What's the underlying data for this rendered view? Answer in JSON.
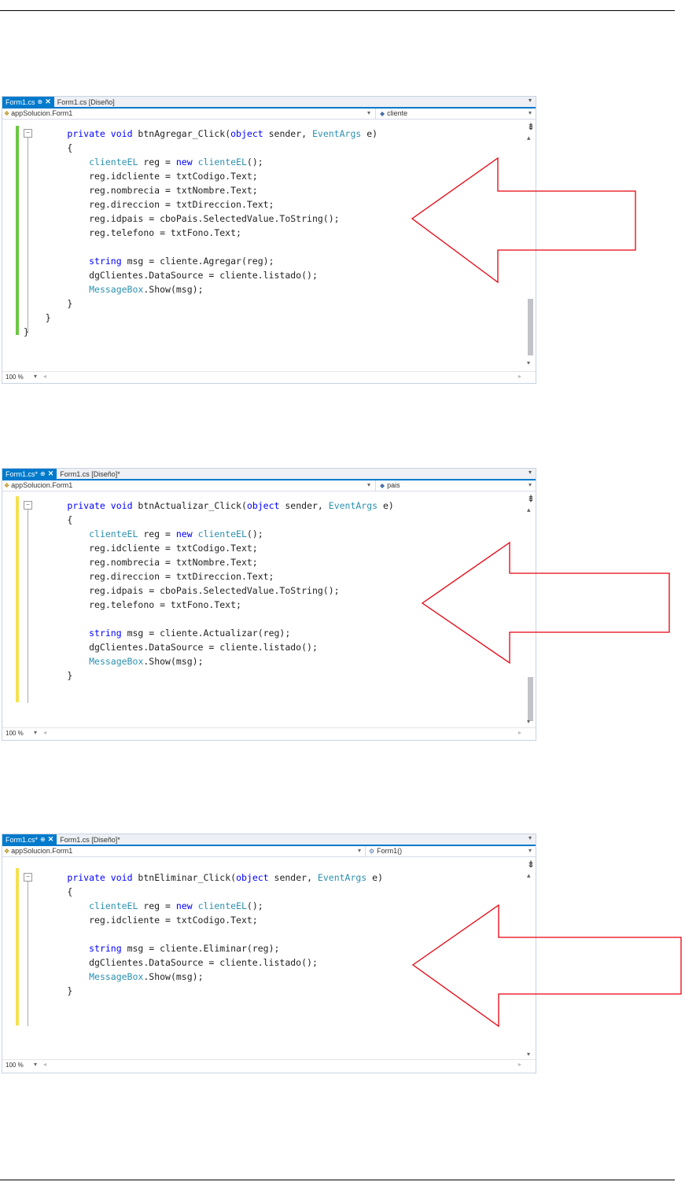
{
  "screenshots": [
    {
      "tab_active": "Form1.cs",
      "tab_inactive": "Form1.cs [Diseño]",
      "nav_class": "appSolucion.Form1",
      "nav_member": "cliente",
      "zoom": "100 %",
      "lines": [
        "        private void btnAgregar_Click(object sender, EventArgs e)",
        "        {",
        "            clienteEL reg = new clienteEL();",
        "            reg.idcliente = txtCodigo.Text;",
        "            reg.nombrecia = txtNombre.Text;",
        "            reg.direccion = txtDireccion.Text;",
        "            reg.idpais = cboPais.SelectedValue.ToString();",
        "            reg.telefono = txtFono.Text;",
        "",
        "            string msg = cliente.Agregar(reg);",
        "            dgClientes.DataSource = cliente.listado();",
        "            MessageBox.Show(msg);",
        "        }",
        "    }",
        "}"
      ]
    },
    {
      "tab_active": "Form1.cs*",
      "tab_inactive": "Form1.cs [Diseño]*",
      "nav_class": "appSolucion.Form1",
      "nav_member": "pais",
      "zoom": "100 %",
      "lines": [
        "        private void btnActualizar_Click(object sender, EventArgs e)",
        "        {",
        "            clienteEL reg = new clienteEL();",
        "            reg.idcliente = txtCodigo.Text;",
        "            reg.nombrecia = txtNombre.Text;",
        "            reg.direccion = txtDireccion.Text;",
        "            reg.idpais = cboPais.SelectedValue.ToString();",
        "            reg.telefono = txtFono.Text;",
        "",
        "            string msg = cliente.Actualizar(reg);",
        "            dgClientes.DataSource = cliente.listado();",
        "            MessageBox.Show(msg);",
        "        }"
      ]
    },
    {
      "tab_active": "Form1.cs*",
      "tab_inactive": "Form1.cs [Diseño]*",
      "nav_class": "appSolucion.Form1",
      "nav_member": "Form1()",
      "zoom": "100 %",
      "lines": [
        "        private void btnEliminar_Click(object sender, EventArgs e)",
        "        {",
        "            clienteEL reg = new clienteEL();",
        "            reg.idcliente = txtCodigo.Text;",
        "",
        "            string msg = cliente.Eliminar(reg);",
        "            dgClientes.DataSource = cliente.listado();",
        "            MessageBox.Show(msg);",
        "        }"
      ]
    }
  ],
  "colors": {
    "tab_accent": "#007acc",
    "saved_change_bar": "#6cc644",
    "unsaved_change_bar": "#f5e050",
    "keyword": "#0000ff",
    "type": "#2b91af",
    "arrow_outline": "#e8000d"
  }
}
